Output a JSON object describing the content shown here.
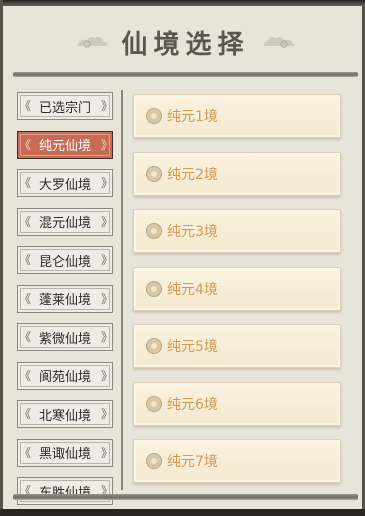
{
  "title": "仙境选择",
  "colors": {
    "accent": "#c76b55",
    "item_text": "#d29a55"
  },
  "tabs": [
    {
      "label": "已选宗门",
      "active": false
    },
    {
      "label": "纯元仙境",
      "active": true
    },
    {
      "label": "大罗仙境",
      "active": false
    },
    {
      "label": "混元仙境",
      "active": false
    },
    {
      "label": "昆仑仙境",
      "active": false
    },
    {
      "label": "蓬莱仙境",
      "active": false
    },
    {
      "label": "紫微仙境",
      "active": false
    },
    {
      "label": "阆苑仙境",
      "active": false
    },
    {
      "label": "北寒仙境",
      "active": false
    },
    {
      "label": "黑诹仙境",
      "active": false
    },
    {
      "label": "东胜仙境",
      "active": false
    }
  ],
  "items": [
    {
      "label": "纯元1境"
    },
    {
      "label": "纯元2境"
    },
    {
      "label": "纯元3境"
    },
    {
      "label": "纯元4境"
    },
    {
      "label": "纯元5境"
    },
    {
      "label": "纯元6境"
    },
    {
      "label": "纯元7境"
    }
  ]
}
